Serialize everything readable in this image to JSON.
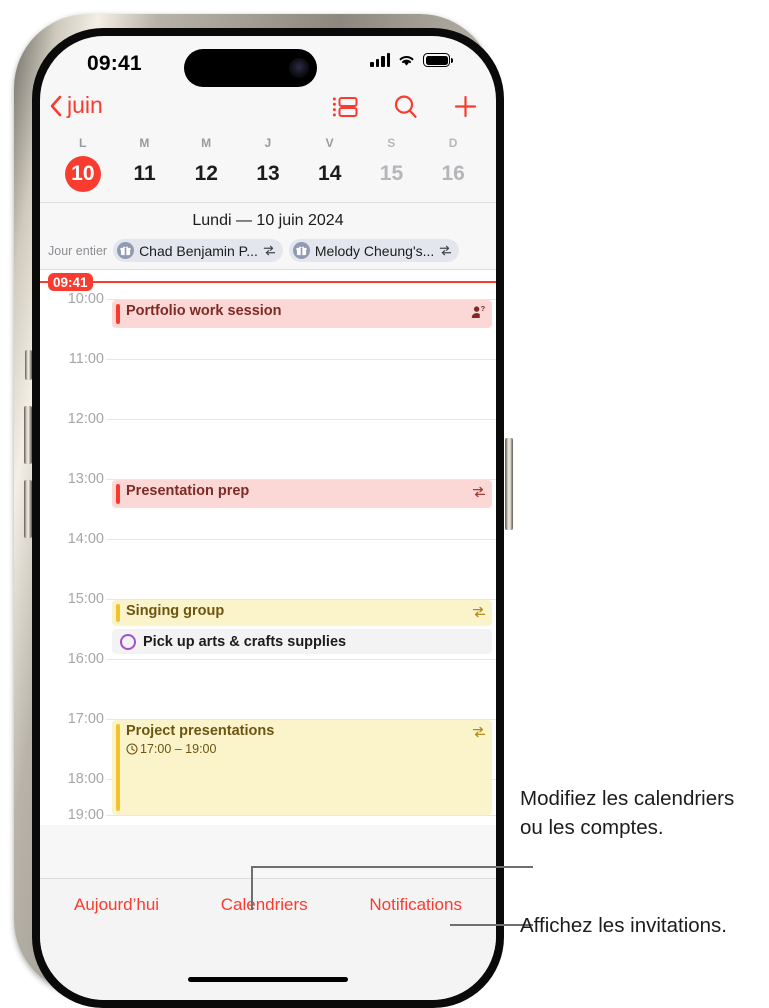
{
  "status_bar": {
    "time": "09:41",
    "signal_icon": "cellular-signal-icon",
    "wifi_icon": "wifi-icon",
    "battery_icon": "battery-icon"
  },
  "nav": {
    "back_label": "juin",
    "back_icon": "chevron-left-icon",
    "actions": [
      {
        "name": "day-list-view-toggle",
        "icon": "list-view-icon"
      },
      {
        "name": "search-button",
        "icon": "search-icon"
      },
      {
        "name": "add-event-button",
        "icon": "plus-icon"
      }
    ]
  },
  "week_strip": {
    "day_initials": [
      "L",
      "M",
      "M",
      "J",
      "V",
      "S",
      "D"
    ],
    "day_numbers": [
      "10",
      "11",
      "12",
      "13",
      "14",
      "15",
      "16"
    ],
    "today_index": 0,
    "weekend_indices": [
      5,
      6
    ],
    "today_color": "#fa3b2f"
  },
  "day_header": {
    "title": "Lundi —  10 juin 2024"
  },
  "all_day": {
    "label": "Jour entier",
    "events": [
      {
        "title": "Chad Benjamin P...",
        "icon": "gift-icon",
        "repeat_icon": "repeat-icon"
      },
      {
        "title": "Melody Cheung's...",
        "icon": "gift-icon",
        "repeat_icon": "repeat-icon"
      }
    ]
  },
  "timeline": {
    "now_label": "09:41",
    "hours": [
      "10:00",
      "11:00",
      "12:00",
      "13:00",
      "14:00",
      "15:00",
      "16:00",
      "17:00",
      "18:00",
      "19:00"
    ],
    "events": [
      {
        "title": "Portfolio work session",
        "color": "red",
        "accent": "#f73b2c",
        "badge_icon": "person-question-icon",
        "subtitle": ""
      },
      {
        "title": "Presentation prep",
        "color": "red",
        "accent": "#f73b2c",
        "badge_icon": "repeat-icon",
        "subtitle": ""
      },
      {
        "title": "Singing group",
        "color": "yellow",
        "accent": "#f2c230",
        "badge_icon": "repeat-icon",
        "subtitle": ""
      },
      {
        "title": "Project presentations",
        "color": "yellow",
        "accent": "#f2c230",
        "badge_icon": "repeat-icon",
        "subtitle": "17:00 – 19:00",
        "subtitle_icon": "clock-icon"
      }
    ],
    "reminders": [
      {
        "title": "Pick up arts & crafts supplies",
        "checkbox_icon": "circle-checkbox-icon",
        "color": "#a64ed0"
      }
    ]
  },
  "toolbar": {
    "today_label": "Aujourd’hui",
    "calendars_label": "Calendriers",
    "notifications_label": "Notifications"
  },
  "callouts": [
    {
      "text": "Modifiez les calendriers ou les comptes."
    },
    {
      "text": "Affichez les invitations."
    }
  ]
}
